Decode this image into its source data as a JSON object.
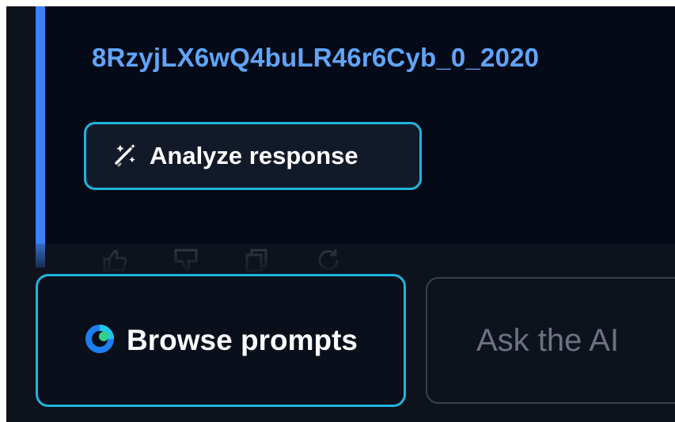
{
  "message": {
    "link_text": "8RzyjLX6wQ4buLR46r6Cyb_0_2020",
    "analyze_label": "Analyze response"
  },
  "icons": {
    "analyze": "magic-wand-icon",
    "browse": "prompts-logo-icon",
    "actions": [
      "thumbs-up-icon",
      "thumbs-down-icon",
      "copy-icon",
      "regenerate-icon"
    ]
  },
  "composer": {
    "browse_label": "Browse prompts",
    "ask_placeholder": "Ask the AI"
  },
  "colors": {
    "accent": "#3b82f6",
    "link": "#60a5fa",
    "button_border": "#1fb4dc",
    "background": "#0d121c"
  }
}
